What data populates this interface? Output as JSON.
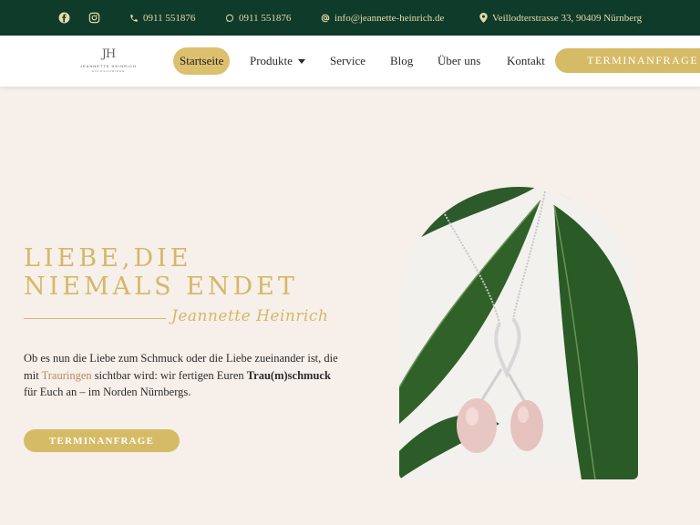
{
  "topbar": {
    "phone": "0911 551876",
    "whatsapp": "0911 551876",
    "email": "info@jeannette-heinrich.de",
    "address": "Veillodterstrasse 33, 90409 Nürnberg",
    "icons": [
      "facebook-icon",
      "instagram-icon",
      "phone-icon",
      "whatsapp-icon",
      "at-icon",
      "map-pin-icon"
    ]
  },
  "logo": {
    "monogram": "JH",
    "name": "JEANNETTE HEINRICH",
    "subtitle": "GOLDSCHMIEDE"
  },
  "nav": {
    "items": [
      "Startseite",
      "Produkte",
      "Service",
      "Blog",
      "Über uns",
      "Kontakt"
    ],
    "active": "Startseite",
    "cta": "TERMINANFRAGE"
  },
  "hero": {
    "headline_line1": "Liebe,die",
    "headline_line2": "niemals endet",
    "signature": "Jeannette Heinrich",
    "para_before": "Ob es nun die Liebe zum Schmuck oder die Liebe zueinander ist, die mit ",
    "para_link": "Trauringen",
    "para_middle": " sichtbar wird: wir fertigen Euren ",
    "para_bold": "Trau(m)schmuck",
    "para_after": " für Euch an – im Norden Nürnbergs.",
    "cta": "TERMINANFRAGE"
  },
  "colors": {
    "topbar_bg": "#0f3b2b",
    "topbar_text": "#e7d9a8",
    "gold": "#d4b867",
    "button_gold": "#d6bb66",
    "page_bg": "#f6efea",
    "link": "#b78a5a"
  }
}
